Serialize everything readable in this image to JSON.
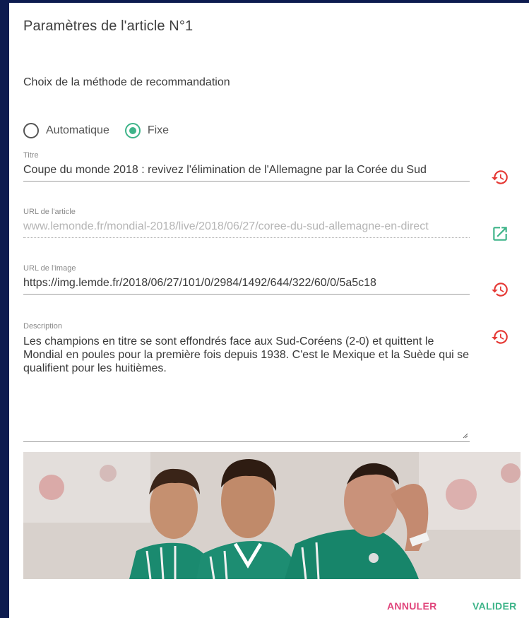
{
  "dialog": {
    "title": "Paramètres de l'article N°1"
  },
  "recommendation": {
    "label": "Choix de la méthode de recommandation",
    "options": [
      {
        "label": "Automatique",
        "checked": false
      },
      {
        "label": "Fixe",
        "checked": true
      }
    ]
  },
  "fields": {
    "title": {
      "label": "Titre",
      "value": "Coupe du monde 2018 : revivez l'élimination de l'Allemagne par la Corée du Sud",
      "icon": "history-icon"
    },
    "article_url": {
      "label": "URL de l'article",
      "value": "www.lemonde.fr/mondial-2018/live/2018/06/27/coree-du-sud-allemagne-en-direct",
      "icon": "open-in-new-icon"
    },
    "image_url": {
      "label": "URL de l'image",
      "value": "https://img.lemde.fr/2018/06/27/101/0/2984/1492/644/322/60/0/5a5c18",
      "icon": "history-icon"
    },
    "description": {
      "label": "Description",
      "value": "Les champions en titre se sont effondrés face aux Sud-Coréens (2-0) et quittent le Mondial en poules pour la première fois depuis 1938. C'est le Mexique et la Suède qui se qualifient pour les huitièmes.",
      "icon": "history-icon"
    }
  },
  "actions": {
    "cancel": "ANNULER",
    "validate": "VALIDER"
  },
  "colors": {
    "accent_green": "#3eb489",
    "cancel_pink": "#e0457b",
    "history_red": "#e53935",
    "background": "#0d1b4f"
  }
}
